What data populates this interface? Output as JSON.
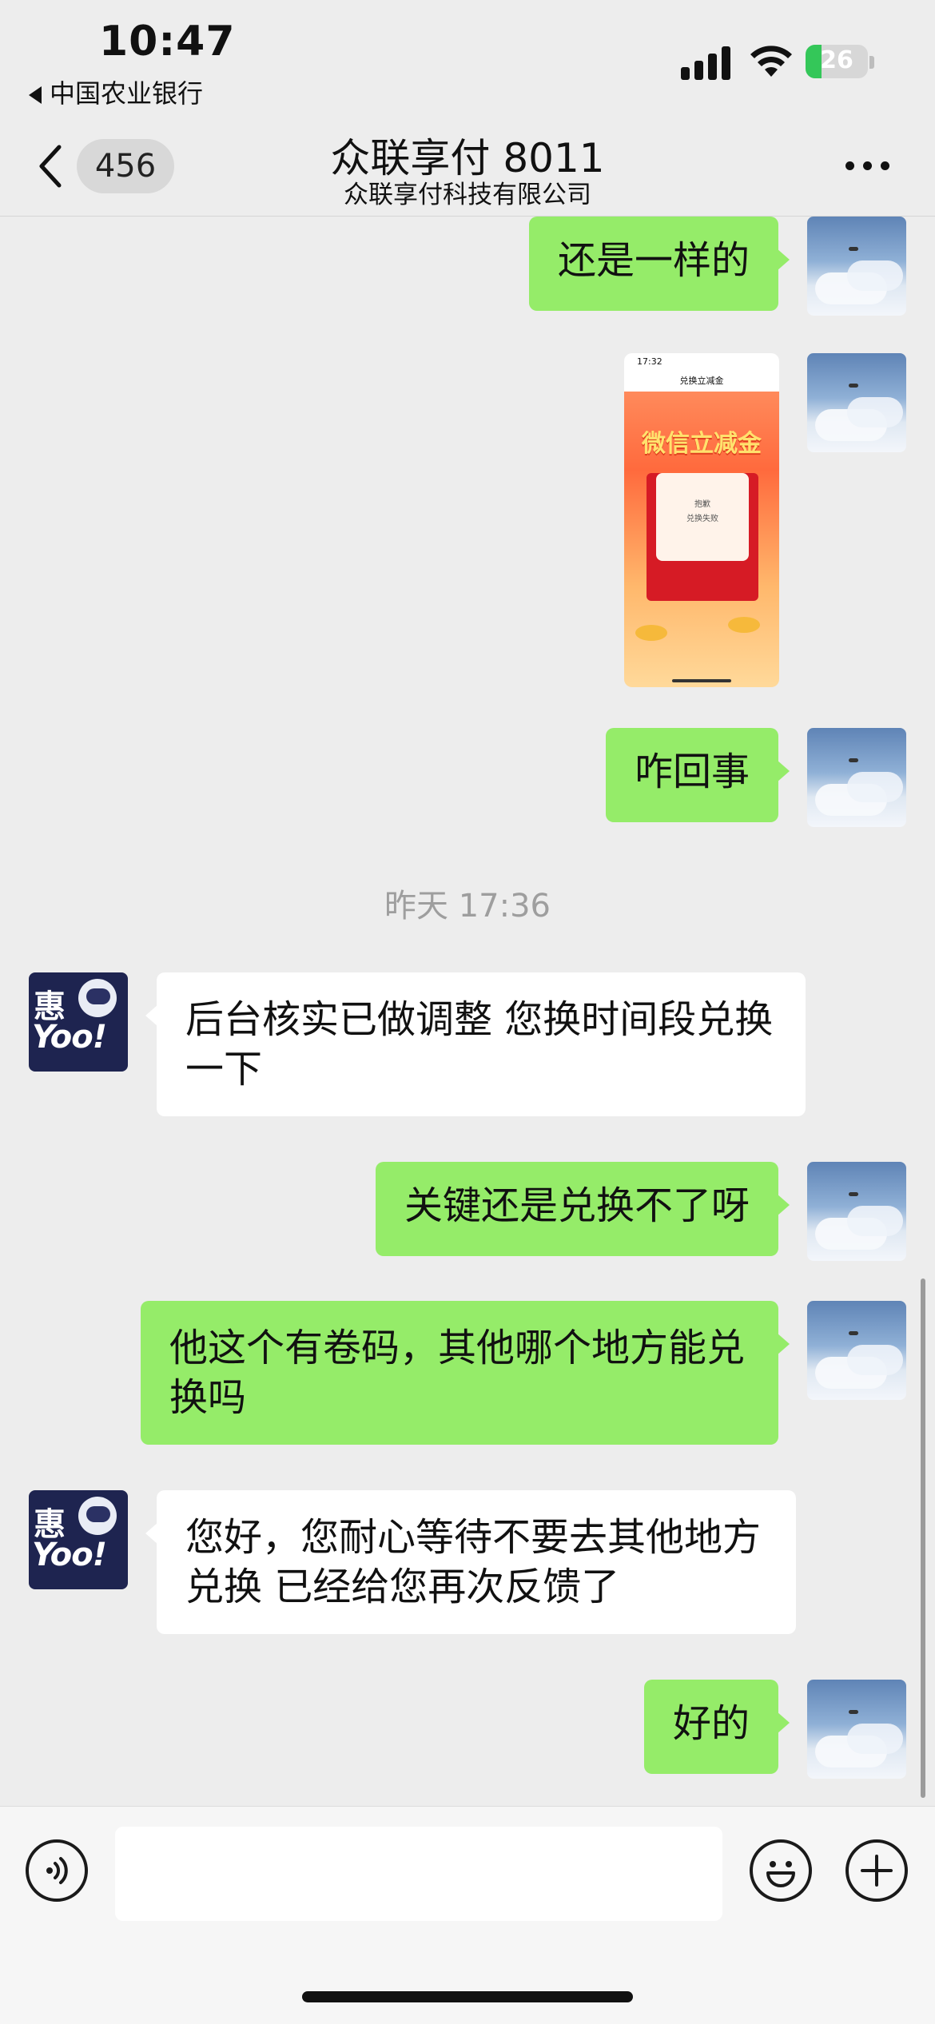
{
  "status_bar": {
    "time": "10:47",
    "back_app": "中国农业银行",
    "battery": "26",
    "battery_level": 0.26
  },
  "nav": {
    "unread_count": "456",
    "title": "众联享付 8011",
    "subtitle": "众联享付科技有限公司"
  },
  "messages": [
    {
      "from": "me",
      "type": "text",
      "text": "还是一样的"
    },
    {
      "from": "me",
      "type": "image",
      "image": {
        "status_time": "17:32",
        "page_title": "兑换立减金",
        "headline": "微信立减金",
        "card_line1": "抱歉",
        "card_line2": "兑换失败"
      }
    },
    {
      "from": "me",
      "type": "text",
      "text": "咋回事"
    },
    {
      "type": "time",
      "text": "昨天 17:36"
    },
    {
      "from": "other",
      "type": "text",
      "text": "后台核实已做调整 您换时间段兑换一下"
    },
    {
      "from": "me",
      "type": "text",
      "text": "关键还是兑换不了呀"
    },
    {
      "from": "me",
      "type": "text",
      "text": "他这个有卷码，其他哪个地方能兑换吗"
    },
    {
      "from": "other",
      "type": "text",
      "text": "您好，您耐心等待不要去其他地方兑换 已经给您再次反馈了"
    },
    {
      "from": "me",
      "type": "text",
      "text": "好的"
    }
  ],
  "bot_avatar": {
    "line1": "惠",
    "line2": "Yoo!"
  },
  "input": {
    "value": "",
    "placeholder": ""
  },
  "icons": {
    "back": "chevron-left-icon",
    "more": "more-icon",
    "voice": "voice-icon",
    "emoji": "emoji-icon",
    "plus": "plus-icon"
  },
  "colors": {
    "my_bubble": "#95ec69",
    "other_bubble": "#ffffff",
    "background": "#ededed",
    "battery_fill": "#34c759"
  }
}
